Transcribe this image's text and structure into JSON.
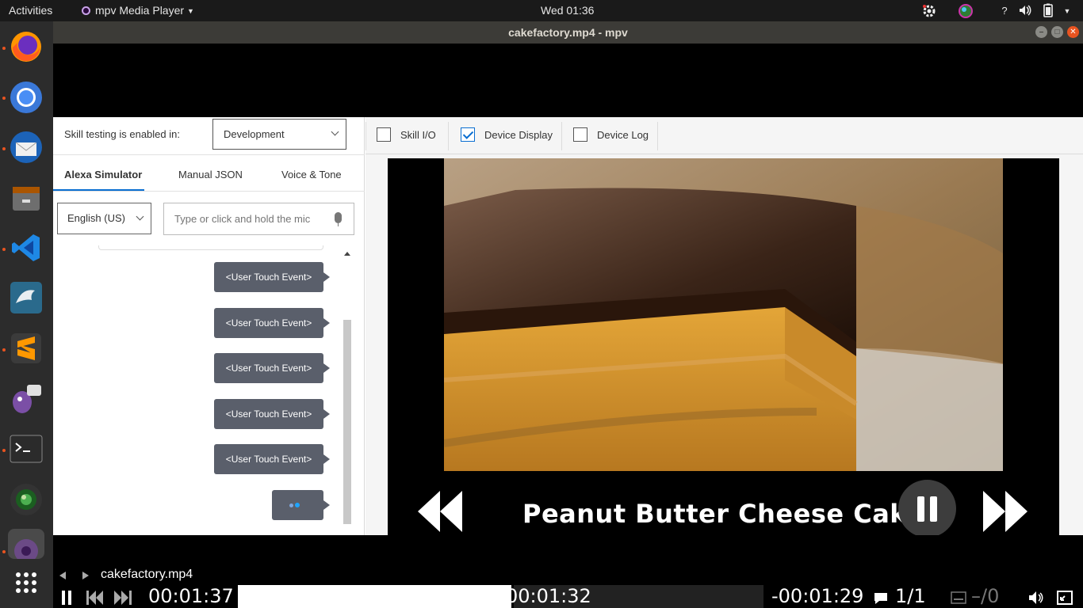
{
  "topbar": {
    "activities": "Activities",
    "app_name": "mpv Media Player",
    "clock": "Wed 01:36"
  },
  "dock": {
    "items": [
      "firefox-icon",
      "chromium-icon",
      "thunderbird-icon",
      "files-icon",
      "vscode-icon",
      "mysql-workbench-icon",
      "sublime-text-icon",
      "pidgin-icon",
      "terminal-icon",
      "camera-icon",
      "mpv-icon",
      "app-grid-icon"
    ]
  },
  "window": {
    "title": "cakefactory.mp4 - mpv"
  },
  "console": {
    "skill_testing_label": "Skill testing is enabled in:",
    "environment": "Development",
    "tabs": [
      "Alexa Simulator",
      "Manual JSON",
      "Voice & Tone"
    ],
    "active_tab": "Alexa Simulator",
    "language": "English (US)",
    "input_placeholder": "Type or click and hold the mic",
    "messages": [
      "<User Touch Event>",
      "<User Touch Event>",
      "<User Touch Event>",
      "<User Touch Event>",
      "<User Touch Event>"
    ],
    "checkboxes": [
      {
        "label": "Skill I/O",
        "checked": false
      },
      {
        "label": "Device Display",
        "checked": true
      },
      {
        "label": "Device Log",
        "checked": false
      }
    ],
    "device_display": {
      "title": "Peanut Butter Cheese Cake"
    }
  },
  "player": {
    "filename": "cakefactory.mp4",
    "elapsed": "00:01:37",
    "hover_time": "00:01:32",
    "remaining": "-00:01:29",
    "subtitle_track": "1/1",
    "audio_track": "–/0",
    "progress_fraction": 0.52,
    "accent_color": "#ffffff"
  }
}
